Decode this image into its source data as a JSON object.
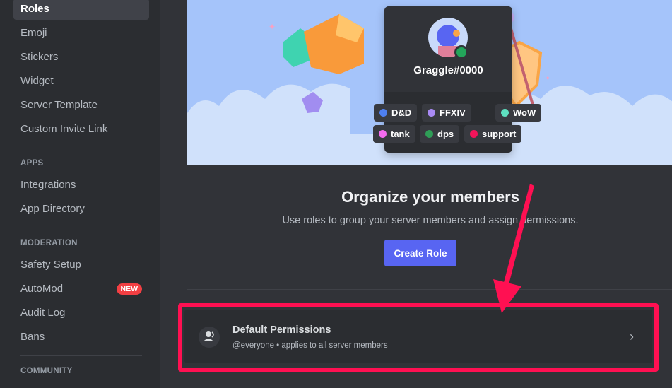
{
  "sidebar": {
    "items_top": [
      {
        "label": "Roles",
        "active": true
      },
      {
        "label": "Emoji"
      },
      {
        "label": "Stickers"
      },
      {
        "label": "Widget"
      },
      {
        "label": "Server Template"
      },
      {
        "label": "Custom Invite Link"
      }
    ],
    "sections": [
      {
        "title": "APPS",
        "items": [
          {
            "label": "Integrations"
          },
          {
            "label": "App Directory"
          }
        ]
      },
      {
        "title": "MODERATION",
        "items": [
          {
            "label": "Safety Setup"
          },
          {
            "label": "AutoMod",
            "badge": "NEW"
          },
          {
            "label": "Audit Log"
          },
          {
            "label": "Bans"
          }
        ]
      },
      {
        "title": "COMMUNITY",
        "items": []
      }
    ]
  },
  "hero": {
    "username": "Graggle#0000",
    "roles": [
      {
        "label": "D&D",
        "color": "#4e7ff0"
      },
      {
        "label": "FFXIV",
        "color": "#a98af5"
      },
      {
        "label": "WoW",
        "color": "#5ee0c0"
      },
      {
        "label": "tank",
        "color": "#f46bef"
      },
      {
        "label": "dps",
        "color": "#2f9e57"
      },
      {
        "label": "support",
        "color": "#f2145a"
      }
    ]
  },
  "main": {
    "title": "Organize your members",
    "description": "Use roles to group your server members and assign permissions.",
    "create_role_label": "Create Role",
    "default_permissions": {
      "title": "Default Permissions",
      "subtitle": "@everyone • applies to all server members"
    }
  },
  "annotation": {
    "color": "#ff1052"
  }
}
